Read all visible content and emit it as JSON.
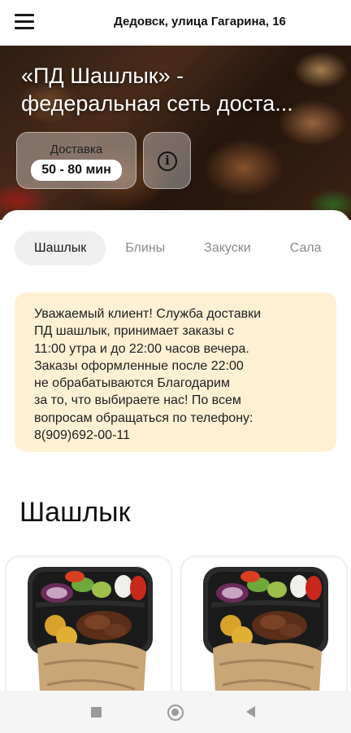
{
  "header": {
    "address": "Дедовск, улица Гагарина, 16",
    "menu_icon": "hamburger-menu-icon"
  },
  "hero": {
    "title_line1": "«ПД Шашлык» -",
    "title_line2": "федеральная сеть доста...",
    "delivery_label": "Доставка",
    "delivery_time": "50 - 80 мин",
    "info_icon": "info-icon",
    "info_glyph": "i"
  },
  "tabs": [
    {
      "label": "Шашлык",
      "active": true
    },
    {
      "label": "Блины",
      "active": false
    },
    {
      "label": "Закуски",
      "active": false
    },
    {
      "label": "Сала",
      "active": false
    }
  ],
  "notice": {
    "lines": [
      "Уважаемый клиент! Служба доставки",
      "ПД шашлык, принимает заказы с",
      "11:00 утра и до 22:00 часов вечера.",
      "Заказы оформленные после 22:00",
      "не обрабатываются Благодарим",
      "за то, что выбираете нас!  По всем",
      "вопросам обращаться по телефону:",
      "8(909)692-00-11"
    ]
  },
  "section": {
    "title": "Шашлык"
  },
  "products": [
    {
      "image": "shashlik-combo-photo"
    },
    {
      "image": "shashlik-combo-photo"
    }
  ],
  "system_nav": {
    "recents_icon": "square-recents-icon",
    "home_icon": "circle-home-icon",
    "back_icon": "triangle-back-icon"
  },
  "colors": {
    "notice_bg": "#fdf0d3",
    "tab_active_bg": "#efefef",
    "tab_inactive_text": "#8a8a8a"
  }
}
